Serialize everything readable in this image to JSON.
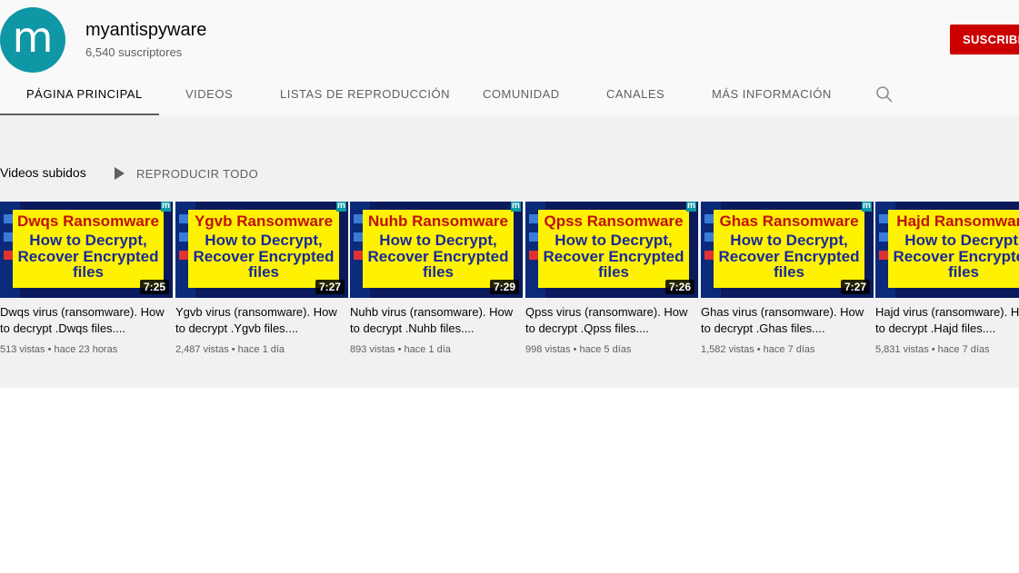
{
  "channel": {
    "avatar_letter": "m",
    "name": "myantispyware",
    "subscribers": "6,540 suscriptores",
    "subscribe_label": "SUSCRIBIRSE",
    "avatar_color": "#0f97a6",
    "subscribe_color": "#cc0000"
  },
  "tabs": [
    {
      "label": "PÁGINA PRINCIPAL",
      "active": true
    },
    {
      "label": "VIDEOS"
    },
    {
      "label": "LISTAS DE REPRODUCCIÓN"
    },
    {
      "label": "COMUNIDAD"
    },
    {
      "label": "CANALES"
    },
    {
      "label": "MÁS INFORMACIÓN"
    }
  ],
  "search_icon": "search-icon",
  "shelf": {
    "title": "Videos subidos",
    "play_all_label": "REPRODUCIR TODO",
    "play_icon": "play-icon"
  },
  "videos": [
    {
      "thumb_title": "Dwqs Ransomware",
      "thumb_text": "How to Decrypt, Recover Encrypted files",
      "duration": "7:25",
      "title": "Dwqs virus (ransomware). How to decrypt .Dwqs files....",
      "views": "513 vistas",
      "age": "hace 23 horas"
    },
    {
      "thumb_title": "Ygvb Ransomware",
      "thumb_text": "How to Decrypt, Recover Encrypted files",
      "duration": "7:27",
      "title": "Ygvb virus (ransomware). How to decrypt .Ygvb files....",
      "views": "2,487 vistas",
      "age": "hace 1 día"
    },
    {
      "thumb_title": "Nuhb Ransomware",
      "thumb_text": "How to Decrypt, Recover Encrypted files",
      "duration": "7:29",
      "title": "Nuhb virus (ransomware). How to decrypt .Nuhb files....",
      "views": "893 vistas",
      "age": "hace 1 día"
    },
    {
      "thumb_title": "Qpss Ransomware",
      "thumb_text": "How to Decrypt, Recover Encrypted files",
      "duration": "7:26",
      "title": "Qpss virus (ransomware). How to decrypt .Qpss files....",
      "views": "998 vistas",
      "age": "hace 5 días"
    },
    {
      "thumb_title": "Ghas Ransomware",
      "thumb_text": "How to Decrypt, Recover Encrypted files",
      "duration": "7:27",
      "title": "Ghas virus (ransomware). How to decrypt .Ghas files....",
      "views": "1,582 vistas",
      "age": "hace 7 días"
    },
    {
      "thumb_title": "Hajd Ransomware",
      "thumb_text": "How to Decrypt, Recover Encrypted files",
      "duration": "",
      "title": "Hajd virus (ransomware). How to decrypt .Hajd files....",
      "views": "5,831 vistas",
      "age": "hace 7 días"
    }
  ]
}
